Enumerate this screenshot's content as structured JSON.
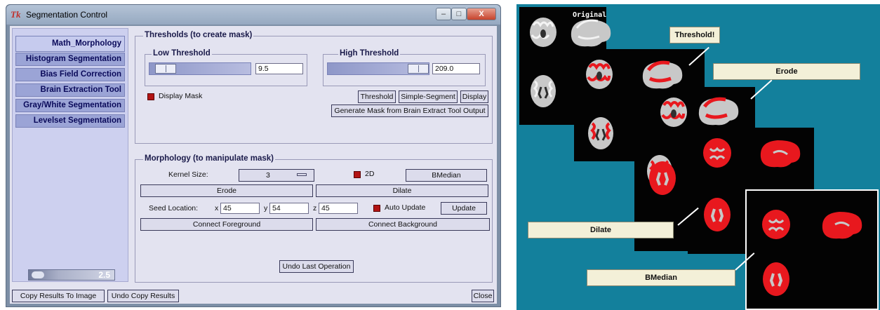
{
  "window": {
    "logo": "Tk",
    "title": "Segmentation Control",
    "min_glyph": "–",
    "max_glyph": "□",
    "close_glyph": "X"
  },
  "sidebar": {
    "tabs": [
      {
        "label": "Math_Morphology",
        "selected": true
      },
      {
        "label": "Histogram Segmentation",
        "selected": false
      },
      {
        "label": "Bias Field Correction",
        "selected": false
      },
      {
        "label": "Brain Extraction Tool",
        "selected": false
      },
      {
        "label": "Gray/White Segmentation",
        "selected": false
      },
      {
        "label": "Levelset Segmentation",
        "selected": false
      }
    ],
    "zoom_value": "2.5"
  },
  "thresholds": {
    "title": "Thresholds (to create mask)",
    "low": {
      "title": "Low Threshold",
      "value": "9.5"
    },
    "high": {
      "title": "High Threshold",
      "value": "209.0"
    },
    "display_mask_label": "Display Mask",
    "display_mask_checked": true,
    "threshold_button": "Threshold",
    "simple_segment_button": "Simple-Segment",
    "display_button": "Display",
    "generate_mask_button": "Generate Mask from Brain Extract Tool Output"
  },
  "morphology": {
    "title": "Morphology (to manipulate mask)",
    "kernel_size_label": "Kernel Size:",
    "kernel_size_value": "3",
    "twod_label": "2D",
    "twod_checked": true,
    "bmedian_button": "BMedian",
    "erode_button": "Erode",
    "dilate_button": "Dilate",
    "seed_location_label": "Seed Location:",
    "x_label": "x",
    "x_value": "45",
    "y_label": "y",
    "y_value": "54",
    "z_label": "z",
    "z_value": "45",
    "auto_update_label": "Auto Update",
    "auto_update_checked": true,
    "update_button": "Update",
    "connect_foreground_button": "Connect Foreground",
    "connect_background_button": "Connect Background",
    "undo_last_button": "Undo Last Operation"
  },
  "bottom": {
    "copy_results_button": "Copy Results To Image",
    "undo_copy_button": "Undo Copy Results",
    "close_button": "Close"
  },
  "figure": {
    "original_label": "Original",
    "buttons": {
      "threshold": "Threshold!",
      "erode": "Erode",
      "dilate": "Dilate",
      "bmedian": "BMedian"
    },
    "colors": {
      "background": "#13809c",
      "mask": "#e8181e",
      "tissue": "#c8c8c8"
    }
  }
}
